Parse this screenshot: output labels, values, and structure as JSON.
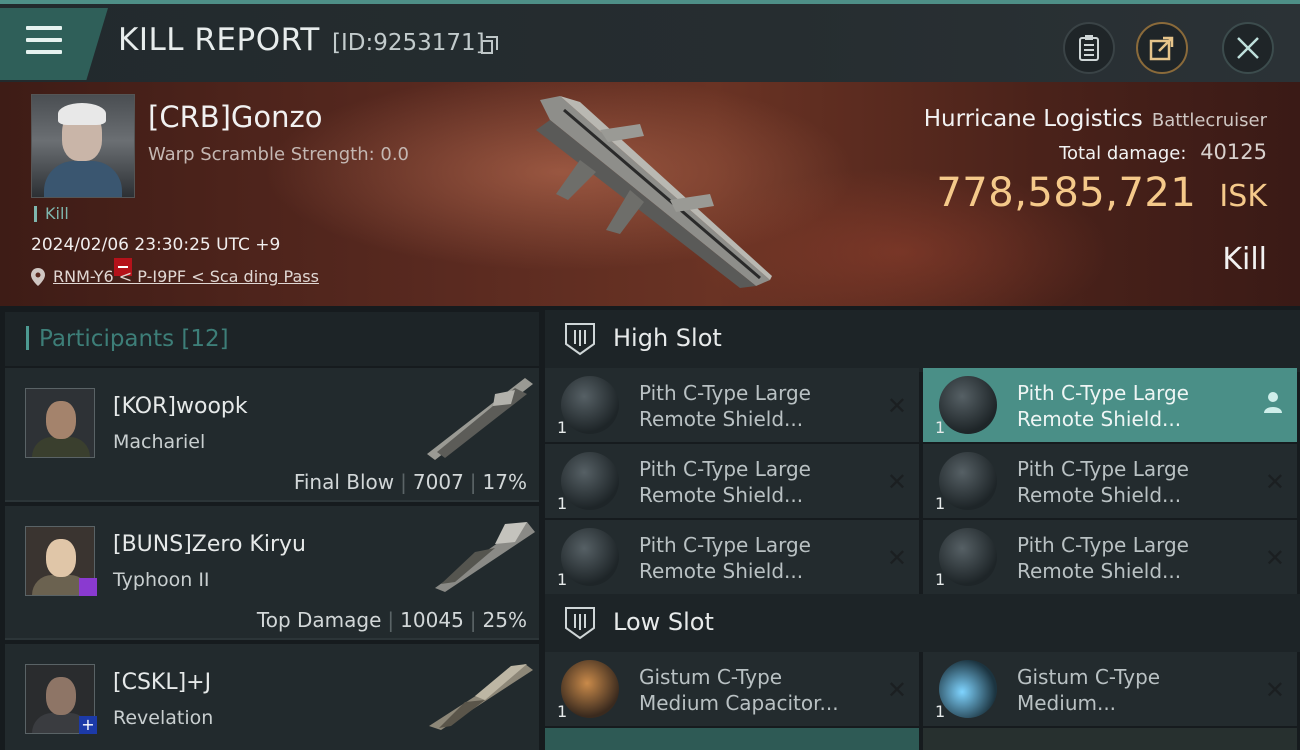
{
  "header": {
    "title": "KILL REPORT",
    "id_label": "[ID:9253171]"
  },
  "victim": {
    "name": "[CRB]Gonzo",
    "scramble": "Warp Scramble Strength: 0.0",
    "tag": "Kill",
    "datetime": "2024/02/06 23:30:25 UTC +9",
    "location": "RNM-Y6 < P-I9PF < Sca ding Pass",
    "ship_name": "Hurricane Logistics",
    "ship_class": "Battlecruiser",
    "damage_label": "Total damage:",
    "damage_value": "40125",
    "isk_value": "778,585,721",
    "isk_unit": "ISK",
    "result": "Kill"
  },
  "participants": {
    "label": "Participants",
    "count": "[12]",
    "items": [
      {
        "name": "[KOR]woopk",
        "ship": "Machariel",
        "stat_label": "Final Blow",
        "damage": "7007",
        "percent": "17%"
      },
      {
        "name": "[BUNS]Zero Kiryu",
        "ship": "Typhoon II",
        "stat_label": "Top Damage",
        "damage": "10045",
        "percent": "25%"
      },
      {
        "name": "[CSKL]+J",
        "ship": "Revelation",
        "stat_label": "",
        "damage": "",
        "percent": ""
      }
    ]
  },
  "high_slot": {
    "label": "High Slot",
    "modules": [
      {
        "name_line1": "Pith C-Type Large",
        "name_line2": "Remote Shield...",
        "qty": "1"
      },
      {
        "name_line1": "Pith C-Type Large",
        "name_line2": "Remote Shield...",
        "qty": "1"
      },
      {
        "name_line1": "Pith C-Type Large",
        "name_line2": "Remote Shield...",
        "qty": "1"
      },
      {
        "name_line1": "Pith C-Type Large",
        "name_line2": "Remote Shield...",
        "qty": "1"
      },
      {
        "name_line1": "Pith C-Type Large",
        "name_line2": "Remote Shield...",
        "qty": "1"
      },
      {
        "name_line1": "Pith C-Type Large",
        "name_line2": "Remote Shield...",
        "qty": "1"
      }
    ]
  },
  "low_slot": {
    "label": "Low Slot",
    "modules": [
      {
        "name_line1": "Gistum C-Type",
        "name_line2": "Medium Capacitor...",
        "qty": "1"
      },
      {
        "name_line1": "Gistum C-Type",
        "name_line2": "Medium...",
        "qty": "1"
      }
    ]
  },
  "colors": {
    "accent": "#4d9a92",
    "highlight_row": "#4a8f87",
    "isk_gold": "#f5c98a",
    "banner_red": "#5a2a20"
  },
  "icons": [
    "menu-icon",
    "copy-icon",
    "clipboard-icon",
    "share-icon",
    "close-icon",
    "location-pin-icon",
    "slot-icon",
    "module-icon",
    "remove-icon",
    "person-icon"
  ]
}
